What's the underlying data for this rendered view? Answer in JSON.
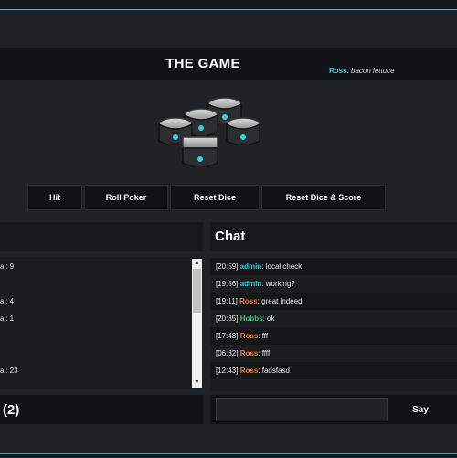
{
  "header": {
    "title": "THE GAME"
  },
  "status": {
    "user": "Ross",
    "message": "bacon lettuce"
  },
  "colors": {
    "accent": "#35c7d6",
    "user_orange": "#f27a2b",
    "user_cyan": "#35c7d6",
    "user_green": "#35c777"
  },
  "dice_icon": "robot-dice-icon",
  "buttons": {
    "hit": "Hit",
    "roll_poker": "Roll Poker",
    "reset_dice": "Reset Dice",
    "reset_dice_score": "Reset Dice & Score"
  },
  "log": {
    "lines": [
      "al: 9",
      "al: 4",
      "al: 1",
      "al: 23"
    ]
  },
  "count": {
    "label": "(2)"
  },
  "chat": {
    "title": "Chat",
    "messages": [
      {
        "time": "[20:59]",
        "user": "admin",
        "text": "local check",
        "color": "#35c7d6"
      },
      {
        "time": "[19:56]",
        "user": "admin",
        "text": "working?",
        "color": "#35c7d6"
      },
      {
        "time": "[19:11]",
        "user": "Ross",
        "text": "great indeed",
        "color": "#f27a2b"
      },
      {
        "time": "[20:35]",
        "user": "Hobbs",
        "text": "ok",
        "color": "#35c777"
      },
      {
        "time": "[17:48]",
        "user": "Ross",
        "text": "fff",
        "color": "#f27a2b"
      },
      {
        "time": "[06:32]",
        "user": "Ross",
        "text": "ffff",
        "color": "#f27a2b"
      },
      {
        "time": "[12:43]",
        "user": "Ross",
        "text": "fadsfasd",
        "color": "#f27a2b"
      }
    ],
    "input_value": "",
    "say_label": "Say"
  }
}
